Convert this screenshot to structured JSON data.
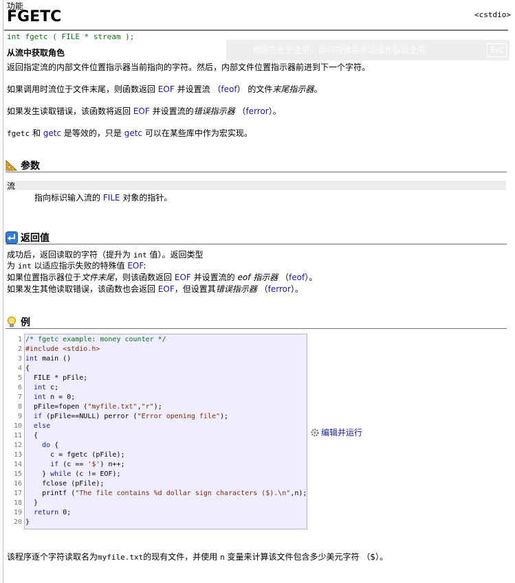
{
  "header": {
    "section_label": "功能",
    "title": "FGETC",
    "header_ref": "<cstdio>",
    "prototype": "int fgetc ( FILE * stream );",
    "subtitle": "从流中获取角色"
  },
  "toast": {
    "message": "你现在处于全屏，即可按键盘手动操作取消全屏",
    "exit_label": "Esc"
  },
  "description": {
    "p1": "返回指定流的内部文件位置指示器当前指向的字符。然后，内部文件位置指示器前进到下一个字符。",
    "p2_a": "如果调用时流位于文件末尾，则函数返回 ",
    "p2_eof": "EOF",
    "p2_b": " 并设置流 （",
    "p2_feof": "feof",
    "p2_c": "） 的文件",
    "p2_d": "末尾指示器",
    "p2_e": "。",
    "p3_a": "如果发生读取错误，该函数将返回 ",
    "p3_eof": "EOF",
    "p3_b": " 并设置流的",
    "p3_c": "错误指示器",
    "p3_d": " （",
    "p3_ferror": "ferror",
    "p3_e": "）。",
    "p4_a": "fgetc",
    "p4_b": " 和 ",
    "p4_getc": "getc",
    "p4_c": " 是等效的，只是 ",
    "p4_getc2": "getc",
    "p4_d": " 可以在某些库中作为宏实现。"
  },
  "params": {
    "heading": "参数",
    "name": "流",
    "desc_a": "指向标识输入流的 ",
    "desc_file": "FILE",
    "desc_b": " 对象的指针。"
  },
  "returns": {
    "heading": "返回值",
    "l1_a": "成功后，返回读取的字符（提升为 ",
    "l1_int": "int",
    "l1_b": " 值）。返回类型",
    "l2_a": "为 ",
    "l2_int": "int",
    "l2_b": " 以适应指示失败的特殊值 ",
    "l2_eof": "EOF",
    "l2_c": ":",
    "l3_a": "如果位置指示器位于",
    "l3_b": "文件末尾",
    "l3_c": "，则该函数返回 ",
    "l3_eof": "EOF",
    "l3_d": " 并设置流的 ",
    "l3_e": "eof 指示器",
    "l3_f": " （",
    "l3_feof": "feof",
    "l3_g": "）。",
    "l4_a": "如果发生其他读取错误，该函数也会返回 ",
    "l4_eof": "EOF",
    "l4_b": "，但设置其",
    "l4_c": "错误指示器",
    "l4_d": " （",
    "l4_ferror": "ferror",
    "l4_e": "）。"
  },
  "example": {
    "heading": "例",
    "run_label": "编辑并运行",
    "line_numbers": [
      "1",
      "2",
      "3",
      "4",
      "5",
      "6",
      "7",
      "8",
      "9",
      "10",
      "11",
      "12",
      "13",
      "14",
      "15",
      "16",
      "17",
      "18",
      "19",
      "20"
    ],
    "code": [
      [
        {
          "t": "/* fgetc example: money counter */",
          "c": "cm"
        }
      ],
      [
        {
          "t": "#include <stdio.h>",
          "c": "pp"
        }
      ],
      [
        {
          "t": "int",
          "c": "kw"
        },
        {
          "t": " main ()",
          "c": ""
        }
      ],
      [
        {
          "t": "{",
          "c": ""
        }
      ],
      [
        {
          "t": "  FILE * pFile;",
          "c": ""
        }
      ],
      [
        {
          "t": "  ",
          "c": ""
        },
        {
          "t": "int",
          "c": "kw"
        },
        {
          "t": " c;",
          "c": ""
        }
      ],
      [
        {
          "t": "  ",
          "c": ""
        },
        {
          "t": "int",
          "c": "kw"
        },
        {
          "t": " n = 0;",
          "c": ""
        }
      ],
      [
        {
          "t": "  pFile=fopen (",
          "c": ""
        },
        {
          "t": "\"myfile.txt\"",
          "c": "st"
        },
        {
          "t": ",",
          "c": ""
        },
        {
          "t": "\"r\"",
          "c": "st"
        },
        {
          "t": ");",
          "c": ""
        }
      ],
      [
        {
          "t": "  ",
          "c": ""
        },
        {
          "t": "if",
          "c": "kw"
        },
        {
          "t": " (pFile==NULL) perror (",
          "c": ""
        },
        {
          "t": "\"Error opening file\"",
          "c": "st"
        },
        {
          "t": ");",
          "c": ""
        }
      ],
      [
        {
          "t": "  ",
          "c": ""
        },
        {
          "t": "else",
          "c": "kw"
        }
      ],
      [
        {
          "t": "  {",
          "c": ""
        }
      ],
      [
        {
          "t": "    ",
          "c": ""
        },
        {
          "t": "do",
          "c": "kw"
        },
        {
          "t": " {",
          "c": ""
        }
      ],
      [
        {
          "t": "      c = fgetc (pFile);",
          "c": ""
        }
      ],
      [
        {
          "t": "      ",
          "c": ""
        },
        {
          "t": "if",
          "c": "kw"
        },
        {
          "t": " (c == ",
          "c": ""
        },
        {
          "t": "'$'",
          "c": "st"
        },
        {
          "t": ") n++;",
          "c": ""
        }
      ],
      [
        {
          "t": "    } ",
          "c": ""
        },
        {
          "t": "while",
          "c": "kw"
        },
        {
          "t": " (c != EOF);",
          "c": ""
        }
      ],
      [
        {
          "t": "    fclose (pFile);",
          "c": ""
        }
      ],
      [
        {
          "t": "    printf (",
          "c": ""
        },
        {
          "t": "\"The file contains %d dollar sign characters ($).\\n\"",
          "c": "st"
        },
        {
          "t": ",n);",
          "c": ""
        }
      ],
      [
        {
          "t": "  }",
          "c": ""
        }
      ],
      [
        {
          "t": "  ",
          "c": ""
        },
        {
          "t": "return",
          "c": "kw"
        },
        {
          "t": " 0;",
          "c": ""
        }
      ],
      [
        {
          "t": "}",
          "c": ""
        }
      ]
    ],
    "caption_a": "该程序逐个字符读取名为",
    "caption_file": "myfile.txt",
    "caption_b": "的现有文件，并使用 ",
    "caption_n": "n",
    "caption_c": " 变量来计算该文件包含多少美元字符 （$）。"
  },
  "colors": {
    "link": "#1a1a9a",
    "prototype": "#0e6f1a",
    "code_bg": "#eeeeff"
  },
  "icons": {
    "params": "ruler-triangle-icon",
    "returns": "return-arrow-icon",
    "example": "lightbulb-icon",
    "run": "gear-icon"
  }
}
